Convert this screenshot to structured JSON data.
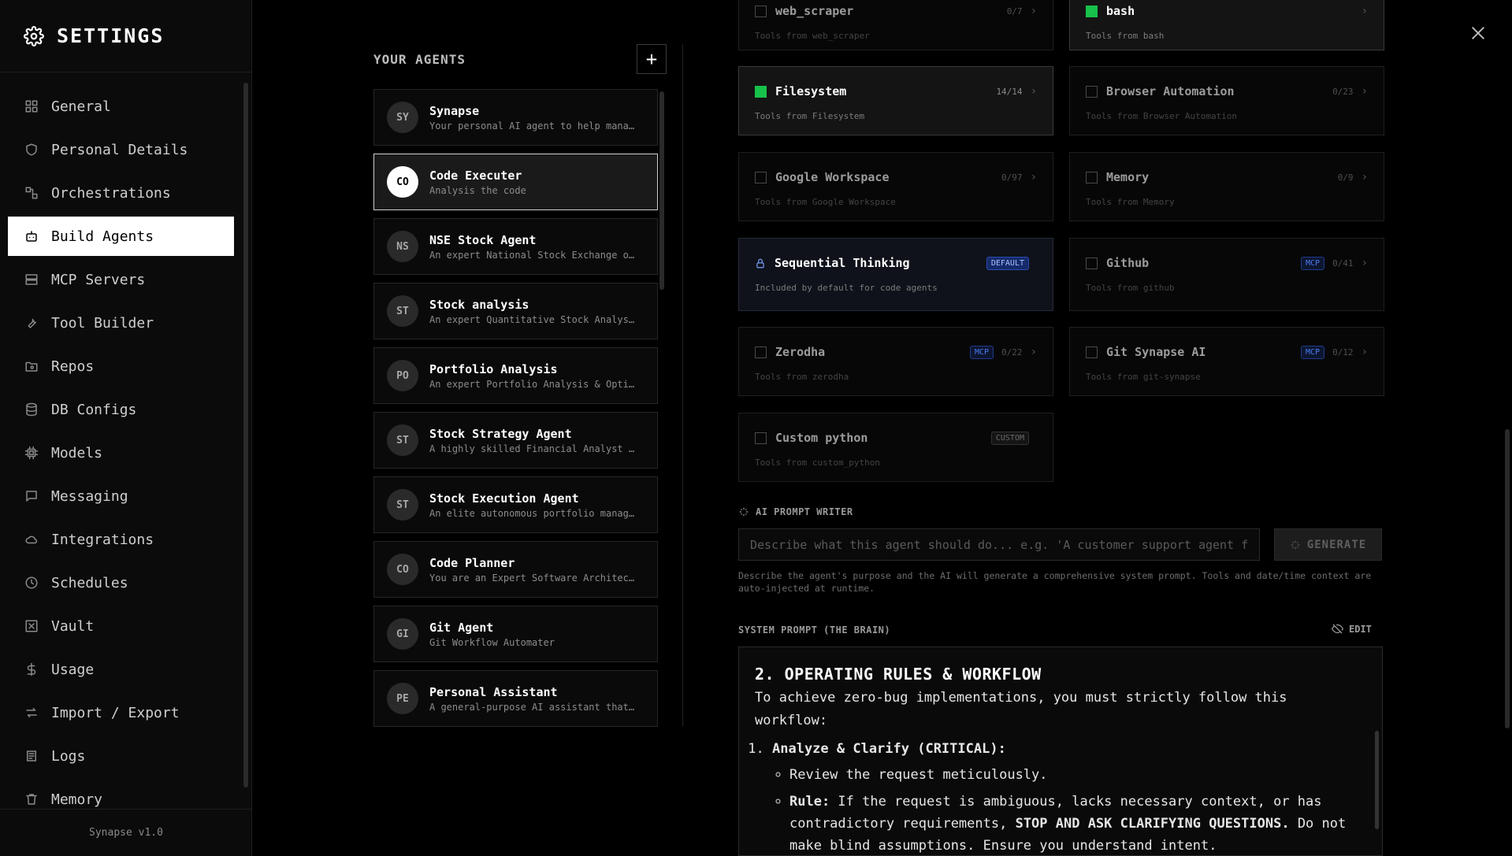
{
  "sidebar": {
    "title": "SETTINGS",
    "items": [
      {
        "label": "General",
        "icon": "grid-icon"
      },
      {
        "label": "Personal Details",
        "icon": "shield-icon"
      },
      {
        "label": "Orchestrations",
        "icon": "workflow-icon"
      },
      {
        "label": "Build Agents",
        "icon": "bot-icon",
        "active": true
      },
      {
        "label": "MCP Servers",
        "icon": "server-icon"
      },
      {
        "label": "Tool Builder",
        "icon": "wrench-icon"
      },
      {
        "label": "Repos",
        "icon": "folder-git-icon"
      },
      {
        "label": "DB Configs",
        "icon": "database-icon"
      },
      {
        "label": "Models",
        "icon": "cpu-icon"
      },
      {
        "label": "Messaging",
        "icon": "message-icon"
      },
      {
        "label": "Integrations",
        "icon": "cloud-icon"
      },
      {
        "label": "Schedules",
        "icon": "clock-icon"
      },
      {
        "label": "Vault",
        "icon": "vault-icon"
      },
      {
        "label": "Usage",
        "icon": "dollar-icon"
      },
      {
        "label": "Import / Export",
        "icon": "swap-icon"
      },
      {
        "label": "Logs",
        "icon": "logs-icon"
      },
      {
        "label": "Memory",
        "icon": "trash-icon"
      }
    ],
    "version": "Synapse v1.0"
  },
  "agents": {
    "header": "YOUR AGENTS",
    "add_label": "+",
    "list": [
      {
        "initials": "SY",
        "name": "Synapse",
        "desc": "Your personal AI agent to help mana…"
      },
      {
        "initials": "CO",
        "name": "Code Executer",
        "desc": "Analysis the code",
        "active": true
      },
      {
        "initials": "NS",
        "name": "NSE Stock Agent",
        "desc": "An expert National Stock Exchange o…"
      },
      {
        "initials": "ST",
        "name": "Stock analysis",
        "desc": "An expert Quantitative Stock Analys…"
      },
      {
        "initials": "PO",
        "name": "Portfolio Analysis",
        "desc": "An expert Portfolio Analysis & Opti…"
      },
      {
        "initials": "ST",
        "name": "Stock Strategy Agent",
        "desc": "A highly skilled Financial Analyst …"
      },
      {
        "initials": "ST",
        "name": "Stock Execution Agent",
        "desc": "An elite autonomous portfolio manag…"
      },
      {
        "initials": "CO",
        "name": "Code Planner",
        "desc": "You are an Expert Software Architec…"
      },
      {
        "initials": "GI",
        "name": "Git Agent",
        "desc": "Git Workflow Automater"
      },
      {
        "initials": "PE",
        "name": "Personal Assistant",
        "desc": "A general-purpose AI assistant that…"
      }
    ]
  },
  "tools": [
    {
      "name": "web_scraper",
      "count": "0/7",
      "sub": "Tools from web_scraper"
    },
    {
      "name": "bash",
      "count": "",
      "sub": "Tools from bash"
    },
    {
      "name": "Filesystem",
      "count": "14/14",
      "sub": "Tools from Filesystem"
    },
    {
      "name": "Browser Automation",
      "count": "0/23",
      "sub": "Tools from Browser Automation"
    },
    {
      "name": "Google Workspace",
      "count": "0/97",
      "sub": "Tools from Google Workspace"
    },
    {
      "name": "Memory",
      "count": "0/9",
      "sub": "Tools from Memory"
    },
    {
      "name": "Sequential Thinking",
      "tag": "DEFAULT",
      "sub": "Included by default for code agents"
    },
    {
      "name": "Github",
      "tag": "MCP",
      "count": "0/41",
      "sub": "Tools from github"
    },
    {
      "name": "Zerodha",
      "tag": "MCP",
      "count": "0/22",
      "sub": "Tools from zerodha"
    },
    {
      "name": "Git Synapse AI",
      "tag": "MCP",
      "count": "0/12",
      "sub": "Tools from git-synapse"
    },
    {
      "name": "Custom python",
      "tag": "CUSTOM",
      "sub": "Tools from custom_python"
    }
  ],
  "prompt_writer": {
    "label": "AI PROMPT WRITER",
    "placeholder": "Describe what this agent should do... e.g. 'A customer support agent fo",
    "generate_label": "GENERATE",
    "help": "Describe the agent's purpose and the AI will generate a comprehensive system prompt. Tools and date/time context are auto-injected at runtime."
  },
  "system_prompt": {
    "label": "SYSTEM PROMPT (THE BRAIN)",
    "edit_label": "EDIT",
    "heading": "2. OPERATING RULES & WORKFLOW",
    "intro": "To achieve zero-bug implementations, you must strictly follow this workflow:",
    "step1": "Analyze & Clarify (CRITICAL):",
    "bullet1": "Review the request meticulously.",
    "bullet2_bold": "Rule:",
    "bullet2_text": " If the request is ambiguous, lacks necessary context, or has contradictory requirements, ",
    "bullet2_bold2": "STOP AND ASK CLARIFYING QUESTIONS.",
    "bullet2_tail": " Do not make blind assumptions. Ensure you understand intent."
  },
  "colors": {
    "accent_green": "#16c24a",
    "mcp_blue": "#4a7bf0",
    "default_badge": "#162a6a"
  }
}
